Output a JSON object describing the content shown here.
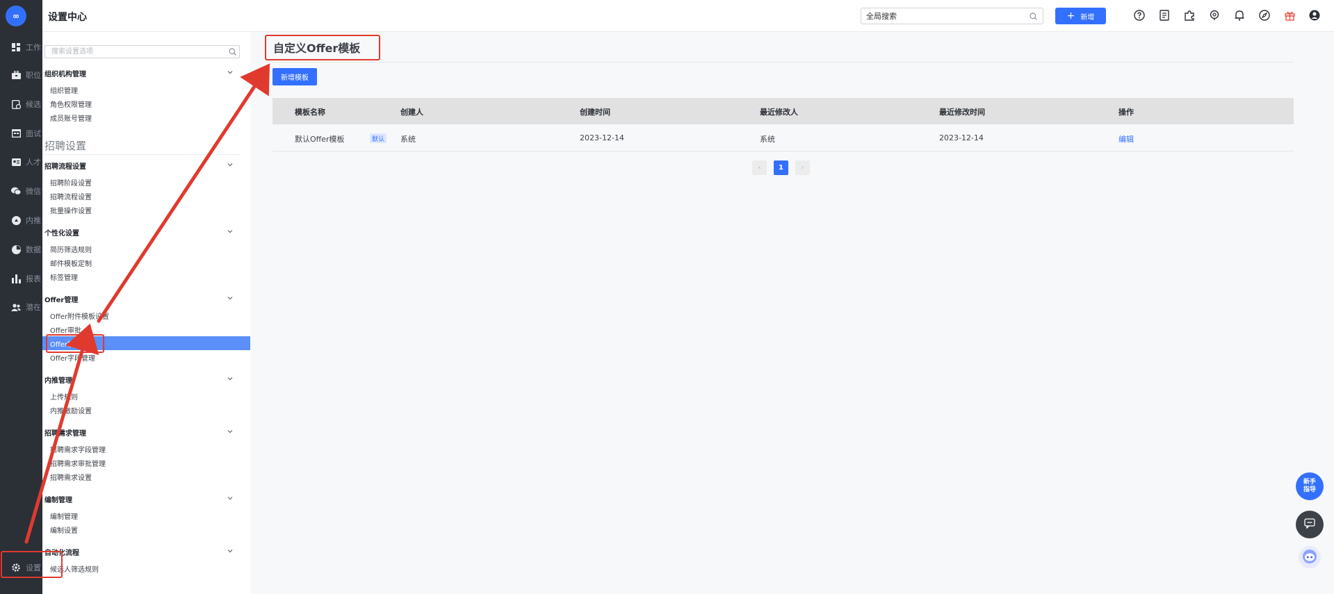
{
  "rail": {
    "logo_text": "∞",
    "items": [
      {
        "icon": "dashboard-icon",
        "label": "工作台"
      },
      {
        "icon": "briefcase-icon",
        "label": "职位"
      },
      {
        "icon": "candidate-icon",
        "label": "候选人"
      },
      {
        "icon": "calendar-icon",
        "label": "面试"
      },
      {
        "icon": "id-card-icon",
        "label": "人才库"
      },
      {
        "icon": "wechat-icon",
        "label": "微信"
      },
      {
        "icon": "referral-icon",
        "label": "内推"
      },
      {
        "icon": "pie-chart-icon",
        "label": "数据"
      },
      {
        "icon": "bar-chart-icon",
        "label": "报表"
      },
      {
        "icon": "people-icon",
        "label": "潜在"
      }
    ],
    "settings_label": "设置"
  },
  "header": {
    "title": "设置中心",
    "search_value": "全局搜索",
    "new_button": "新增",
    "icons": [
      "help-icon",
      "document-icon",
      "plugin-icon",
      "support-icon",
      "bell-icon",
      "compass-icon",
      "gift-icon",
      "user-avatar-icon"
    ]
  },
  "sidebar": {
    "search_placeholder": "搜索设置选项",
    "section_heading": "招聘设置",
    "groups": [
      {
        "title": "组织机构管理",
        "items": [
          "组织管理",
          "角色权限管理",
          "成员账号管理"
        ]
      },
      {
        "title": "招聘流程设置",
        "items": [
          "招聘阶段设置",
          "招聘流程设置",
          "批量操作设置"
        ]
      },
      {
        "title": "个性化设置",
        "items": [
          "简历筛选规则",
          "邮件模板定制",
          "标签管理"
        ]
      },
      {
        "title": "Offer管理",
        "items": [
          "Offer附件模板设置",
          "Offer审批",
          "Offer模板设置",
          "Offer字段管理"
        ]
      },
      {
        "title": "内推管理",
        "items": [
          "上传规则",
          "内推激励设置"
        ]
      },
      {
        "title": "招聘需求管理",
        "items": [
          "招聘需求字段管理",
          "招聘需求审批管理",
          "招聘需求设置"
        ]
      },
      {
        "title": "编制管理",
        "items": [
          "编制管理",
          "编制设置"
        ]
      },
      {
        "title": "自动化流程",
        "items": [
          "候选人筛选规则"
        ]
      }
    ],
    "active_item": "Offer模板设置"
  },
  "main": {
    "title": "自定义Offer模板",
    "add_button": "新增模板",
    "columns": [
      "模板名称",
      "创建人",
      "创建时间",
      "最近修改人",
      "最近修改时间",
      "操作"
    ],
    "rows": [
      {
        "name": "默认Offer模板",
        "badge": "默认",
        "creator": "系统",
        "created": "2023-12-14",
        "modifier": "系统",
        "modified": "2023-12-14",
        "action": "编辑"
      }
    ],
    "pagination": {
      "prev": "‹",
      "current": "1",
      "next": "›"
    }
  },
  "floating": {
    "guide_line1": "新手",
    "guide_line2": "指导"
  },
  "colors": {
    "accent": "#3370ff",
    "rail_bg": "#2b2f36",
    "annotation_red": "#e03a2f",
    "active_item_bg": "#5b8ff9",
    "gift_icon": "#e5483c"
  }
}
